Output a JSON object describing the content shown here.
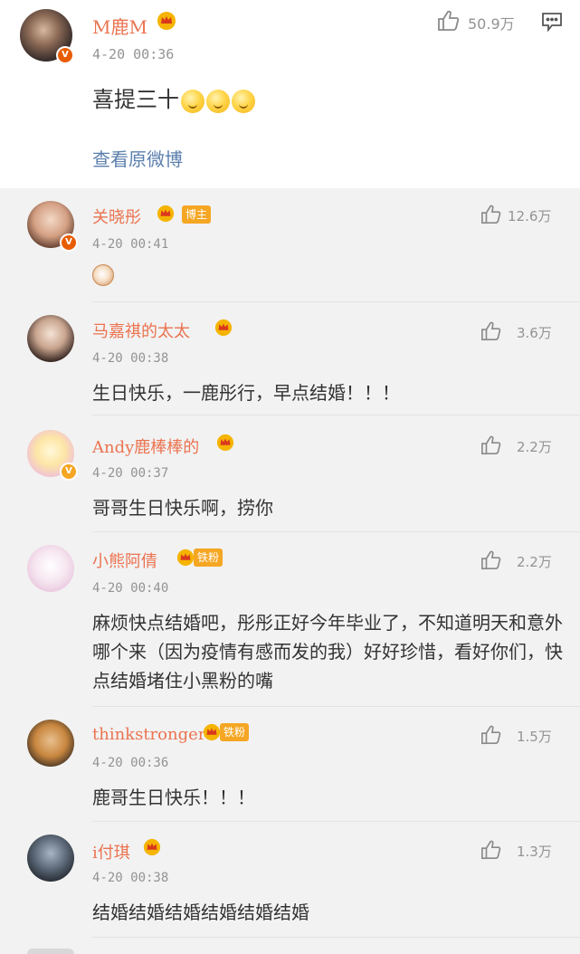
{
  "post": {
    "username": "M鹿M",
    "time": "4-20 00:36",
    "like_count": "50.9万",
    "text": "喜提三十",
    "view_original": "查看原微博"
  },
  "comments": [
    {
      "username": "关晓彤",
      "tag": "博主",
      "time": "4-20 00:41",
      "like_count": "12.6万",
      "text": ""
    },
    {
      "username": "马嘉祺的太太",
      "tag": "",
      "time": "4-20 00:38",
      "like_count": "3.6万",
      "text": "生日快乐，一鹿彤行，早点结婚！！！"
    },
    {
      "username": "Andy鹿棒棒的",
      "tag": "",
      "time": "4-20 00:37",
      "like_count": "2.2万",
      "text": "哥哥生日快乐啊，捞你"
    },
    {
      "username": "小熊阿倩",
      "tag": "铁粉",
      "time": "4-20 00:40",
      "like_count": "2.2万",
      "text": "麻烦快点结婚吧，彤彤正好今年毕业了，不知道明天和意外哪个来（因为疫情有感而发的我）好好珍惜，看好你们，快点结婚堵住小黑粉的嘴"
    },
    {
      "username": "thinkstronger",
      "tag": "铁粉",
      "time": "4-20 00:36",
      "like_count": "1.5万",
      "text": "鹿哥生日快乐！！！"
    },
    {
      "username": "i付琪",
      "tag": "",
      "time": "4-20 00:38",
      "like_count": "1.3万",
      "text": "结婚结婚结婚结婚结婚结婚"
    }
  ],
  "colors": {
    "username": "#eb7350",
    "link": "#5b7fad",
    "meta": "#939393",
    "badge": "#f5a623"
  },
  "icons": [
    "thumbs-up-icon",
    "comment-icon",
    "crown-icon",
    "verified-icon",
    "emoji-icon"
  ]
}
